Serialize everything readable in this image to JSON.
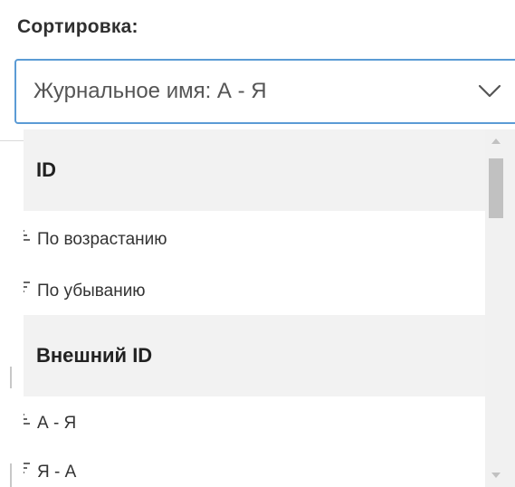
{
  "sort": {
    "label": "Сортировка:",
    "selected": "Журнальное имя: А - Я"
  },
  "dropdown": {
    "groups": [
      {
        "header": "ID",
        "options": [
          {
            "icon": "sort-ascending-icon",
            "label": "По возрастанию"
          },
          {
            "icon": "sort-descending-icon",
            "label": "По убыванию"
          }
        ]
      },
      {
        "header": "Внешний ID",
        "options": [
          {
            "icon": "sort-ascending-icon",
            "label": "А - Я"
          },
          {
            "icon": "sort-descending-icon",
            "label": "Я - А"
          }
        ]
      }
    ]
  },
  "colors": {
    "focus_border": "#5b9bd5",
    "group_header_bg": "#f2f2f2",
    "scrollbar_track": "#f1f1f1",
    "scrollbar_thumb": "#c1c1c1"
  }
}
